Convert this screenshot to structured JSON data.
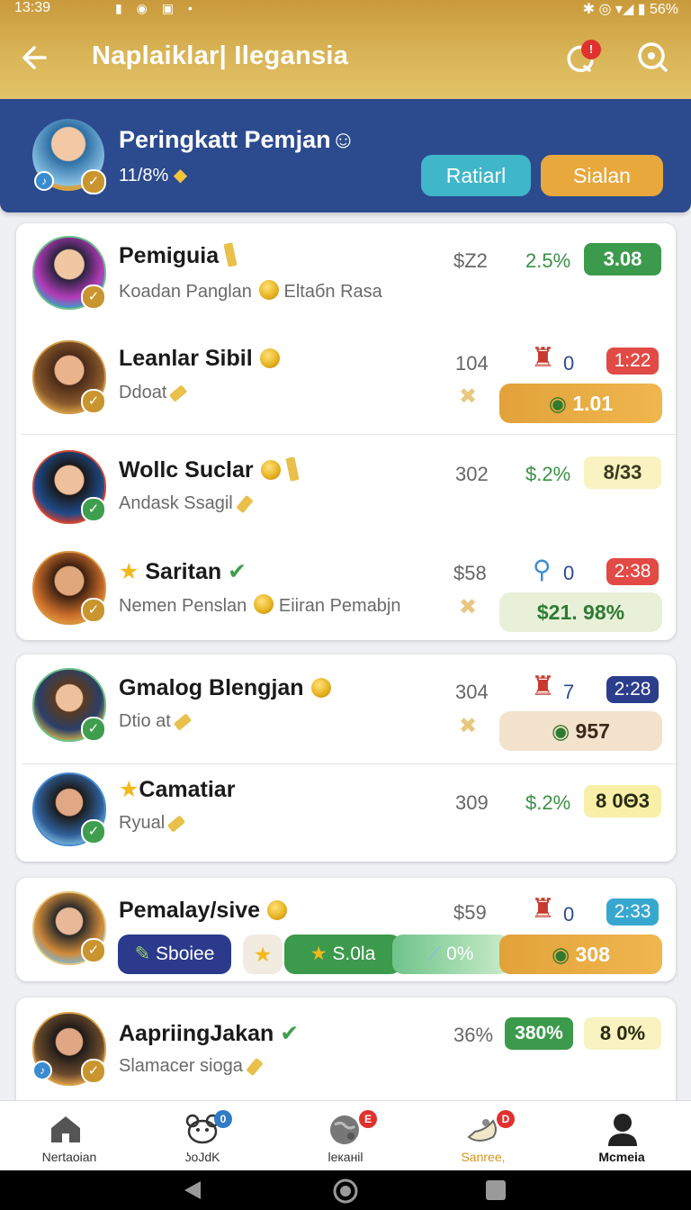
{
  "status": {
    "time": "13:39",
    "battery": "56%"
  },
  "header": {
    "title": "Naplaiklar| Ilegansia",
    "notif_count": "!"
  },
  "banner": {
    "title": "Peringkatt Pemjan☺",
    "subtitle": "11/8%",
    "btn_left": "Ratiarl",
    "btn_right": "Sialan"
  },
  "rows": [
    {
      "name": "Pemiguia",
      "sub1": "Koadan Panglan",
      "sub2": "Eltaбn Rasa",
      "num": "$Z2",
      "pct": "2.5%",
      "tag": "3.08"
    },
    {
      "name": "Leanlar Sibil",
      "sub1": "Ddoat",
      "num": "104",
      "stat": "0",
      "tag": "1:22",
      "bar": "1.01"
    },
    {
      "name": "Wollc Suclar",
      "sub1": "Andask Ssagil",
      "num": "302",
      "pct": "$.2%",
      "tag": "8/33"
    },
    {
      "name": "Saritan",
      "sub1": "Nemen Penslan",
      "sub2": "Eiiran Pemabjn",
      "num": "$58",
      "stat": "0",
      "tag": "2:38",
      "bar": "$21. 98%"
    },
    {
      "name": "Gmalog Blengjan",
      "sub1": "Dtio at",
      "num": "304",
      "stat": "7",
      "tag": "2:28",
      "bar": "957"
    },
    {
      "name": "Camatiar",
      "sub1": "Ryual",
      "num": "309",
      "pct": "$.2%",
      "tag": "8 0Θ3"
    },
    {
      "name": "Pemalay/sive",
      "num": "$59",
      "stat": "0",
      "tag": "2:33",
      "chip1": "Sboiee",
      "chip2": "S.0la",
      "chip3": "0%",
      "bar": "308"
    },
    {
      "name": "AapriingJakan",
      "sub1": "Slamacer sioga",
      "num": "36%",
      "tag1": "380%",
      "tag2": "8 0%"
    }
  ],
  "nav": [
    {
      "label": "Nertaoian",
      "icon": "home-icon"
    },
    {
      "label": "ʖoJdK",
      "icon": "bear-icon",
      "badge": "0"
    },
    {
      "label": "leканil",
      "icon": "globe-icon",
      "badge": "E"
    },
    {
      "label": "Sanree,",
      "icon": "bird-icon",
      "badge": "D"
    },
    {
      "label": "Mcmeia",
      "icon": "person-icon"
    }
  ],
  "colors": {
    "header_gold": "#d9b557",
    "banner_blue": "#2c4a8e",
    "green": "#3b8f46",
    "orange": "#e8a83c",
    "red": "#e0312f"
  }
}
